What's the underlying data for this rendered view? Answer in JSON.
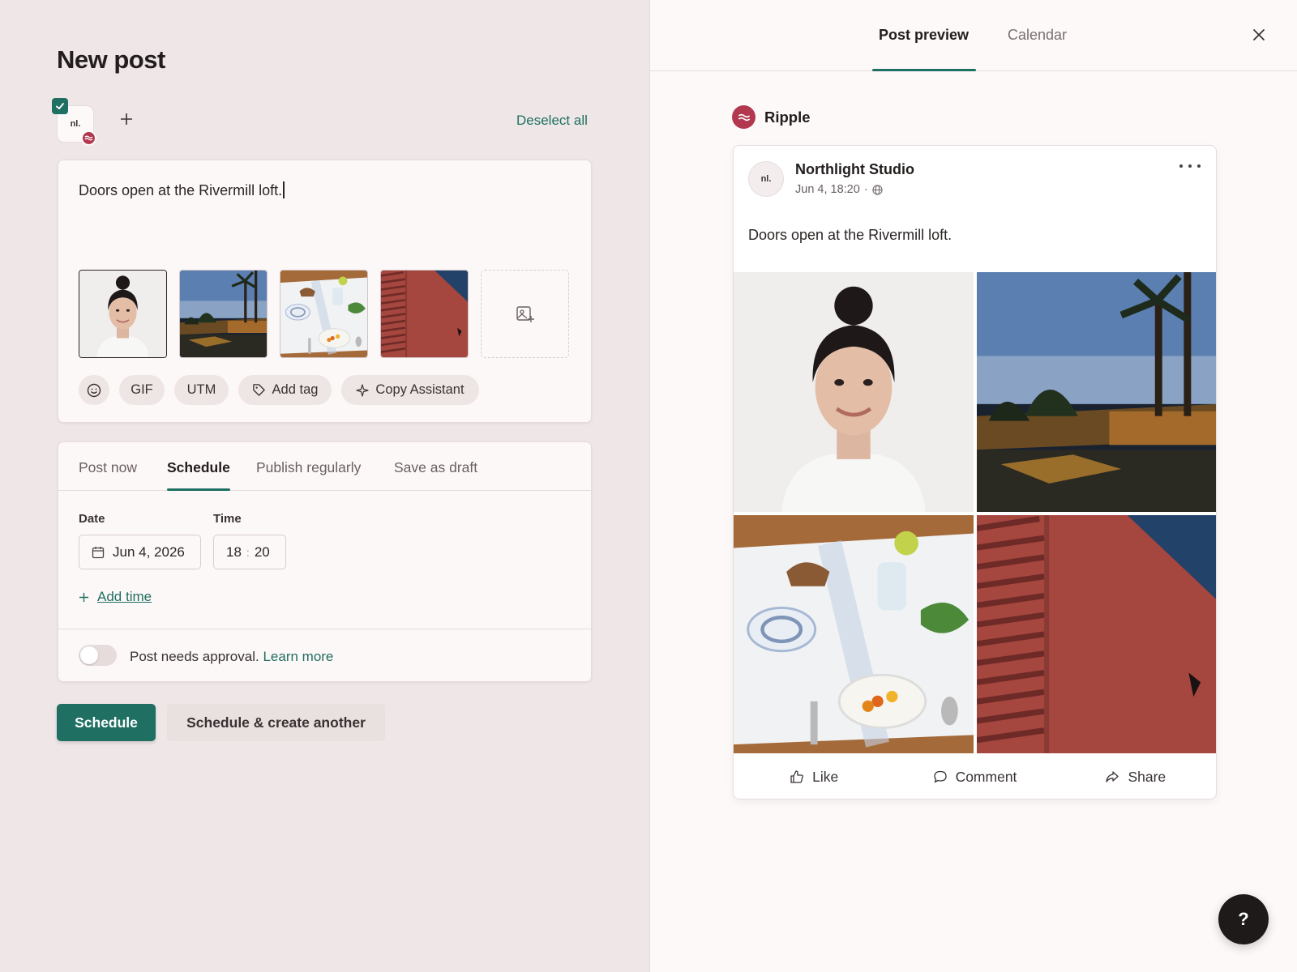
{
  "composer_panel": {
    "title": "New post",
    "account": {
      "initials": "nl.",
      "network": "Ripple"
    },
    "deselect_label": "Deselect all",
    "post_text": "Doors open at the Rivermill loft.",
    "media": [
      {
        "name": "portrait-photo"
      },
      {
        "name": "palm-pool-night-photo"
      },
      {
        "name": "breakfast-table-photo"
      },
      {
        "name": "red-wall-photo"
      }
    ],
    "toolbar": {
      "gif_label": "GIF",
      "utm_label": "UTM",
      "tag_label": "Add tag",
      "assistant_label": "Copy Assistant"
    }
  },
  "schedule": {
    "tabs": [
      {
        "label": "Post now"
      },
      {
        "label": "Schedule",
        "active": true
      },
      {
        "label": "Publish regularly"
      },
      {
        "label": "Save as draft"
      }
    ],
    "date_label": "Date",
    "date_value": "Jun 4, 2026",
    "time_label": "Time",
    "time_hour": "18",
    "time_sep": ":",
    "time_minute": "20",
    "add_time_label": "Add time",
    "approval_text": "Post needs approval.",
    "learn_more": "Learn more",
    "approval_enabled": false
  },
  "buttons": {
    "primary": "Schedule",
    "secondary": "Schedule & create another"
  },
  "preview_panel": {
    "tabs": [
      {
        "label": "Post preview",
        "active": true
      },
      {
        "label": "Calendar"
      }
    ],
    "network_name": "Ripple",
    "author": "Northlight Studio",
    "avatar_initials": "nl.",
    "timestamp": "Jun 4, 18:20",
    "meta_sep": "·",
    "post_text": "Doors open at the Rivermill loft.",
    "actions": {
      "like": "Like",
      "comment": "Comment",
      "share": "Share"
    }
  },
  "help_label": "?",
  "colors": {
    "accent": "#1f6f62",
    "brand_ripple": "#b1384e",
    "left_bg": "#efe7e7",
    "right_bg": "#fdf9f9"
  }
}
